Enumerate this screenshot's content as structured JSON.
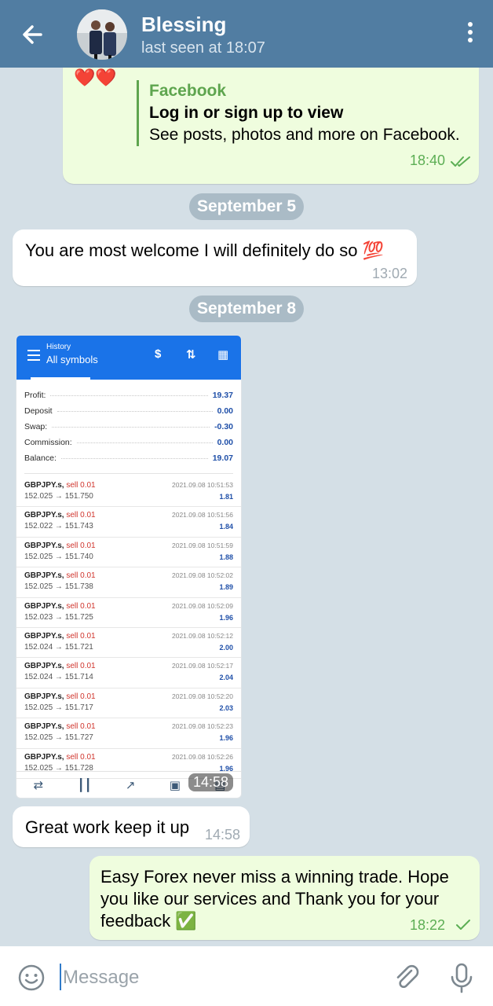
{
  "header": {
    "name": "Blessing",
    "status": "last seen at 18:07"
  },
  "messages": {
    "link_preview": {
      "emoji": "❤️❤️",
      "site": "Facebook",
      "title": "Log in or sign up to view",
      "description": "See posts, photos and more on Facebook.",
      "time": "18:40"
    },
    "date1": "September 5",
    "reply1": {
      "text": "You are most welcome I will definitely do so 💯",
      "time": "13:02"
    },
    "date2": "September 8",
    "image_time": "14:58",
    "reply2": {
      "text": "Great work keep it up",
      "time": "14:58"
    },
    "out_last": {
      "text": "Easy Forex never miss a winning trade. Hope you like our services and Thank you for your feedback ✅",
      "time": "18:22"
    }
  },
  "screenshot": {
    "title_small": "History",
    "title": "All symbols",
    "summary": [
      {
        "label": "Profit:",
        "value": "19.37"
      },
      {
        "label": "Deposit",
        "value": "0.00"
      },
      {
        "label": "Swap:",
        "value": "-0.30"
      },
      {
        "label": "Commission:",
        "value": "0.00"
      },
      {
        "label": "Balance:",
        "value": "19.07"
      }
    ],
    "trades": [
      {
        "symbol": "GBPJPY.s,",
        "side": "sell 0.01",
        "prices": "152.025 → 151.750",
        "time": "2021.09.08 10:51:53",
        "profit": "1.81"
      },
      {
        "symbol": "GBPJPY.s,",
        "side": "sell 0.01",
        "prices": "152.022 → 151.743",
        "time": "2021.09.08 10:51:56",
        "profit": "1.84"
      },
      {
        "symbol": "GBPJPY.s,",
        "side": "sell 0.01",
        "prices": "152.025 → 151.740",
        "time": "2021.09.08 10:51:59",
        "profit": "1.88"
      },
      {
        "symbol": "GBPJPY.s,",
        "side": "sell 0.01",
        "prices": "152.025 → 151.738",
        "time": "2021.09.08 10:52:02",
        "profit": "1.89"
      },
      {
        "symbol": "GBPJPY.s,",
        "side": "sell 0.01",
        "prices": "152.023 → 151.725",
        "time": "2021.09.08 10:52:09",
        "profit": "1.96"
      },
      {
        "symbol": "GBPJPY.s,",
        "side": "sell 0.01",
        "prices": "152.024 → 151.721",
        "time": "2021.09.08 10:52:12",
        "profit": "2.00"
      },
      {
        "symbol": "GBPJPY.s,",
        "side": "sell 0.01",
        "prices": "152.024 → 151.714",
        "time": "2021.09.08 10:52:17",
        "profit": "2.04"
      },
      {
        "symbol": "GBPJPY.s,",
        "side": "sell 0.01",
        "prices": "152.025 → 151.717",
        "time": "2021.09.08 10:52:20",
        "profit": "2.03"
      },
      {
        "symbol": "GBPJPY.s,",
        "side": "sell 0.01",
        "prices": "152.025 → 151.727",
        "time": "2021.09.08 10:52:23",
        "profit": "1.96"
      },
      {
        "symbol": "GBPJPY.s,",
        "side": "sell 0.01",
        "prices": "152.025 → 151.728",
        "time": "2021.09.08 10:52:26",
        "profit": "1.96"
      }
    ]
  },
  "input": {
    "placeholder": "Message"
  },
  "colors": {
    "header": "#517da2",
    "outgoing": "#effdde",
    "incoming": "#ffffff",
    "check": "#5cae54",
    "link": "#5ea54e"
  },
  "icons": [
    "back-arrow-icon",
    "more-vert-icon",
    "emoji-icon",
    "attach-icon",
    "mic-icon",
    "double-check-icon",
    "single-check-icon"
  ]
}
